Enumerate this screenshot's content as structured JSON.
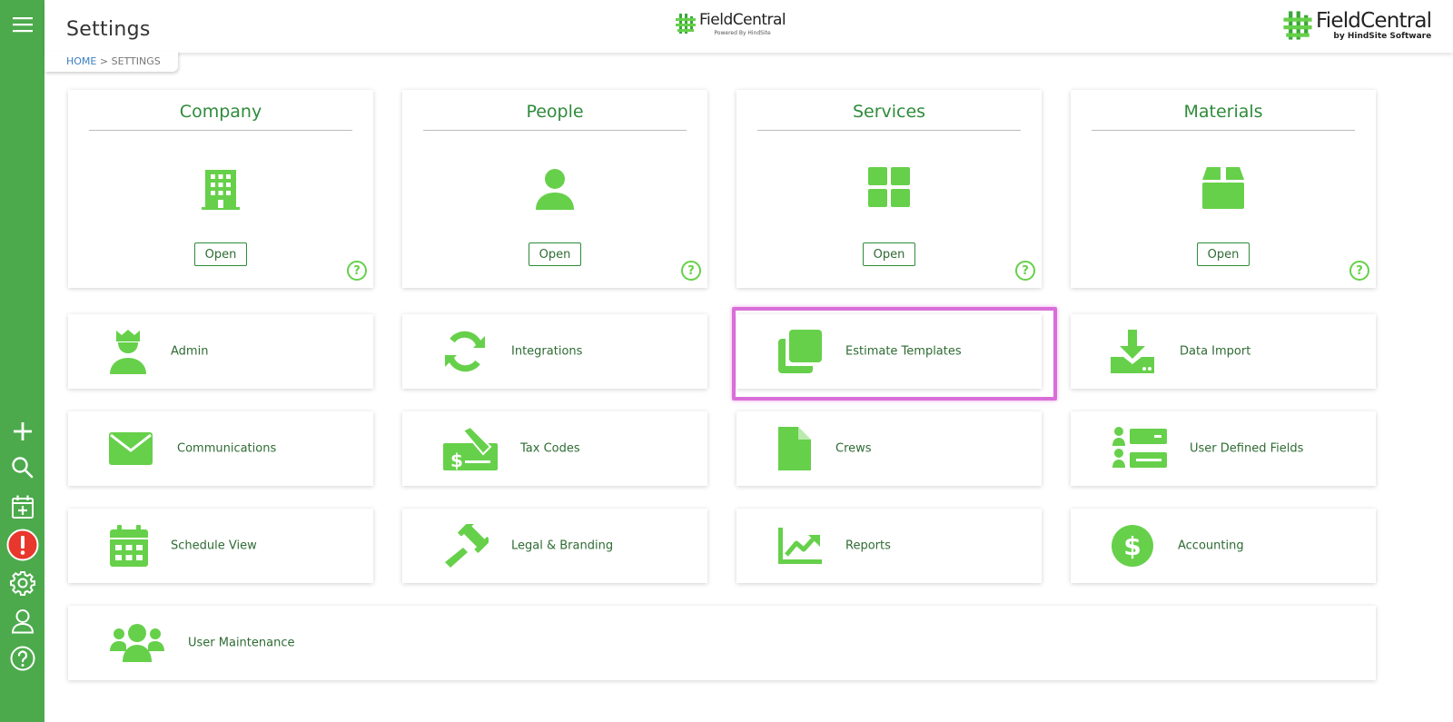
{
  "header": {
    "page_title": "Settings",
    "breadcrumb": {
      "home": "HOME",
      "separator": " > ",
      "current": "SETTINGS"
    },
    "logo_center": {
      "name": "FieldCentral",
      "sub": "Powered By  HindSite"
    },
    "logo_right": {
      "name": "FieldCentral",
      "sub": "by HindSite Software"
    }
  },
  "sidebar": {
    "items": [
      "menu-icon",
      "plus-icon",
      "search-icon",
      "calendar-add-icon",
      "alert-icon",
      "gear-icon",
      "user-icon",
      "help-icon"
    ]
  },
  "cards": {
    "company": {
      "title": "Company",
      "open": "Open",
      "help": "?"
    },
    "people": {
      "title": "People",
      "open": "Open",
      "help": "?"
    },
    "services": {
      "title": "Services",
      "open": "Open",
      "help": "?"
    },
    "materials": {
      "title": "Materials",
      "open": "Open",
      "help": "?"
    }
  },
  "tiles": {
    "admin": "Admin",
    "integrations": "Integrations",
    "estimate_templates": "Estimate Templates",
    "data_import": "Data Import",
    "communications": "Communications",
    "tax_codes": "Tax Codes",
    "crews": "Crews",
    "user_defined_fields": "User Defined Fields",
    "schedule_view": "Schedule View",
    "legal_branding": "Legal & Branding",
    "reports": "Reports",
    "accounting": "Accounting",
    "user_maintenance": "User Maintenance"
  },
  "colors": {
    "sidebar": "#4caa4c",
    "accent": "#66d04a",
    "title_green": "#2e8b3a",
    "highlight": "#d96ed9",
    "alert": "#e8372c"
  }
}
